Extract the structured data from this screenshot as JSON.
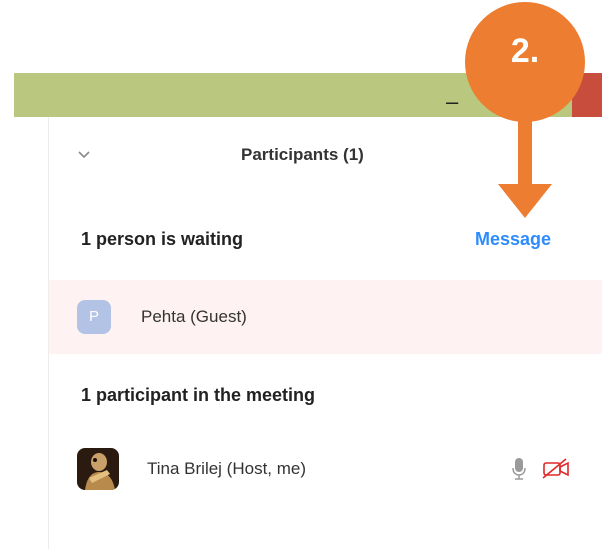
{
  "titlebar": {
    "minimize_glyph": "–"
  },
  "panel": {
    "title": "Participants (1)",
    "waiting": {
      "label": "1 person is waiting",
      "message_button": "Message",
      "guest": {
        "avatar_letter": "P",
        "name": "Pehta (Guest)"
      }
    },
    "meeting": {
      "label": "1 participant in the meeting",
      "host": {
        "name": "Tina Brilej (Host, me)"
      }
    }
  },
  "annotation": {
    "step_label": "2."
  },
  "colors": {
    "titlebar": "#b9c77f",
    "accent": "#2d8cff",
    "waiting_bg": "#fff2f2",
    "callout": "#ed7d31",
    "video_off": "#e02828"
  }
}
